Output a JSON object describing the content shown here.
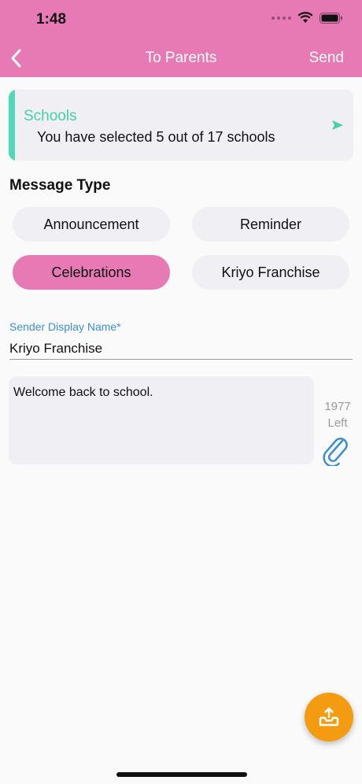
{
  "status_bar": {
    "time": "1:48"
  },
  "nav": {
    "title": "To Parents",
    "send_label": "Send"
  },
  "schools": {
    "title": "Schools",
    "description": "You have selected 5 out of 17 schools"
  },
  "message_type": {
    "label": "Message Type",
    "options": [
      {
        "label": "Announcement",
        "selected": false
      },
      {
        "label": "Reminder",
        "selected": false
      },
      {
        "label": "Celebrations",
        "selected": true
      },
      {
        "label": "Kriyo Franchise",
        "selected": false
      }
    ]
  },
  "sender": {
    "label": "Sender Display Name*",
    "value": "Kriyo Franchise"
  },
  "message": {
    "value": "Welcome back to school.",
    "chars_left_count": "1977",
    "chars_left_label": "Left"
  },
  "colors": {
    "header": "#e77ab5",
    "accent_green": "#4fd9b4",
    "selected_pill": "#e77ab5",
    "label_blue": "#3a8fd6",
    "fab": "#f39c12"
  },
  "icons": {
    "back": "chevron-left-icon",
    "schools_arrow": "send-arrow-icon",
    "attach": "paperclip-icon",
    "fab": "upload-tray-icon",
    "wifi": "wifi-icon",
    "battery": "battery-icon"
  }
}
